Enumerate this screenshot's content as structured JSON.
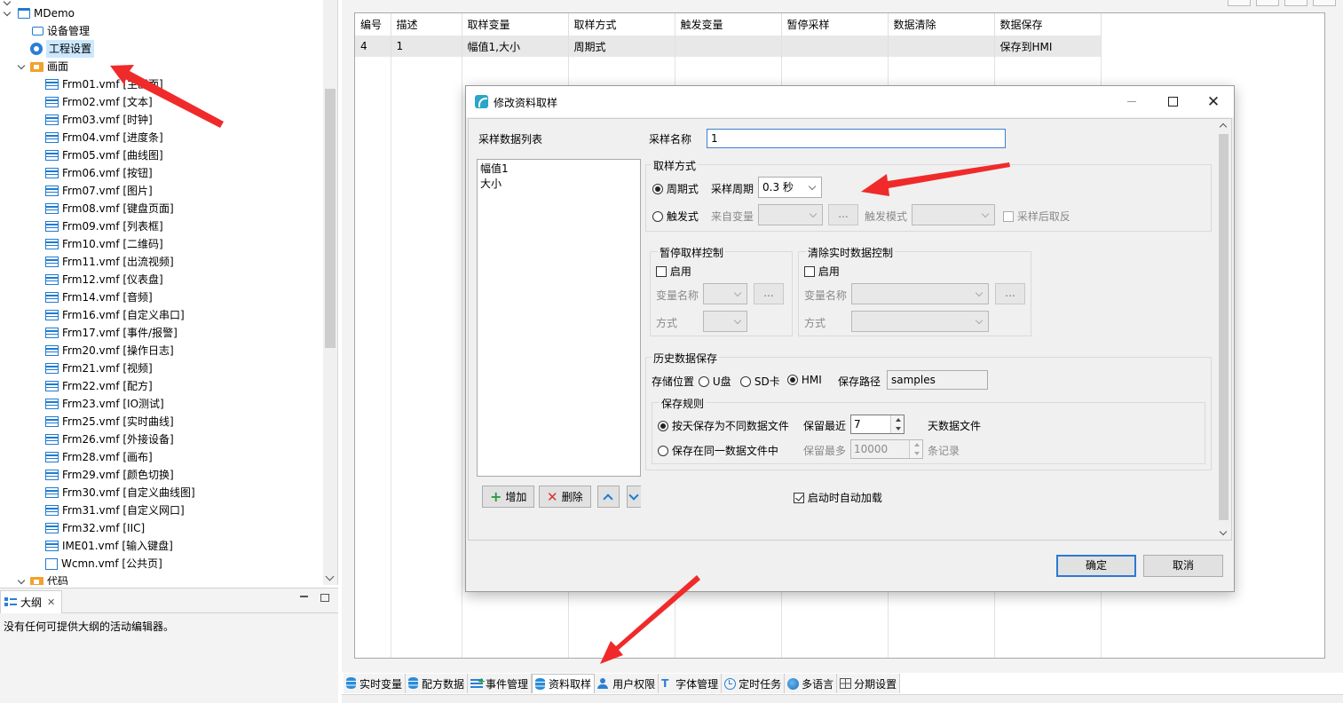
{
  "tree": {
    "project": "MDemo",
    "device_mgmt": "设备管理",
    "project_settings": "工程设置",
    "screens_folder": "画面",
    "screens": [
      "Frm01.vmf [主画面]",
      "Frm02.vmf [文本]",
      "Frm03.vmf [时钟]",
      "Frm04.vmf [进度条]",
      "Frm05.vmf [曲线图]",
      "Frm06.vmf [按钮]",
      "Frm07.vmf [图片]",
      "Frm08.vmf [键盘页面]",
      "Frm09.vmf [列表框]",
      "Frm10.vmf [二维码]",
      "Frm11.vmf [出流视频]",
      "Frm12.vmf [仪表盘]",
      "Frm14.vmf [音频]",
      "Frm16.vmf [自定义串口]",
      "Frm17.vmf [事件/报警]",
      "Frm20.vmf [操作日志]",
      "Frm21.vmf [视频]",
      "Frm22.vmf [配方]",
      "Frm23.vmf [IO测试]",
      "Frm25.vmf [实时曲线]",
      "Frm26.vmf [外接设备]",
      "Frm28.vmf [画布]",
      "Frm29.vmf [颜色切换]",
      "Frm30.vmf [自定义曲线图]",
      "Frm31.vmf [自定义网口]",
      "Frm32.vmf [IIC]",
      "IME01.vmf [输入键盘]",
      "Wcmn.vmf [公共页]"
    ],
    "code_folder": "代码"
  },
  "outline": {
    "tab_label": "大纲",
    "message": "没有任何可提供大纲的活动编辑器。"
  },
  "grid": {
    "headers": [
      "编号",
      "描述",
      "取样变量",
      "取样方式",
      "触发变量",
      "暂停采样",
      "数据清除",
      "数据保存"
    ],
    "rows": [
      [
        "4",
        "1",
        "幅值1,大小",
        "周期式",
        "",
        "",
        "",
        "保存到HMI"
      ]
    ]
  },
  "bottom_tabs": [
    {
      "label": "实时变量",
      "icon": "database-icon"
    },
    {
      "label": "配方数据",
      "icon": "database-icon"
    },
    {
      "label": "事件管理",
      "icon": "event-list-icon"
    },
    {
      "label": "资料取样",
      "icon": "database-icon"
    },
    {
      "label": "用户权限",
      "icon": "users-icon"
    },
    {
      "label": "字体管理",
      "icon": "font-icon"
    },
    {
      "label": "定时任务",
      "icon": "clock-icon"
    },
    {
      "label": "多语言",
      "icon": "globe-icon"
    },
    {
      "label": "分期设置",
      "icon": "grid-icon"
    }
  ],
  "dialog": {
    "title": "修改资料取样",
    "sample_list_label": "采样数据列表",
    "sample_list_items": [
      "幅值1",
      "大小"
    ],
    "add_label": "增加",
    "delete_label": "删除",
    "sample_name_label": "采样名称",
    "sample_name_value": "1",
    "sampling_mode": {
      "title": "取样方式",
      "periodic_label": "周期式",
      "period_label": "采样周期",
      "period_value": "0.3 秒",
      "trigger_label": "触发式",
      "from_var_label": "来自变量",
      "trigger_mode_label": "触发模式",
      "invert_after_label": "采样后取反",
      "ellipsis": "..."
    },
    "pause_ctrl": {
      "title": "暂停取样控制",
      "enable_label": "启用",
      "var_name_label": "变量名称",
      "mode_label": "方式",
      "ellipsis": "..."
    },
    "clear_ctrl": {
      "title": "清除实时数据控制",
      "enable_label": "启用",
      "var_name_label": "变量名称",
      "mode_label": "方式",
      "ellipsis": "..."
    },
    "history": {
      "title": "历史数据保存",
      "location_label": "存储位置",
      "opt_u": "U盘",
      "opt_sd": "SD卡",
      "opt_hmi": "HMI",
      "path_label": "保存路径",
      "path_value": "samples",
      "rules_title": "保存规则",
      "rule_daily": "按天保存为不同数据文件",
      "keep_recent_label": "保留最近",
      "keep_recent_value": "7",
      "days_suffix": "天数据文件",
      "rule_single": "保存在同一数据文件中",
      "keep_max_label": "保留最多",
      "keep_max_value": "10000",
      "records_suffix": "条记录"
    },
    "autoload_label": "启动时自动加载",
    "ok_label": "确定",
    "cancel_label": "取消"
  },
  "colors": {
    "accent": "#1f7bd1",
    "annotation_arrow": "#f02a2a"
  }
}
